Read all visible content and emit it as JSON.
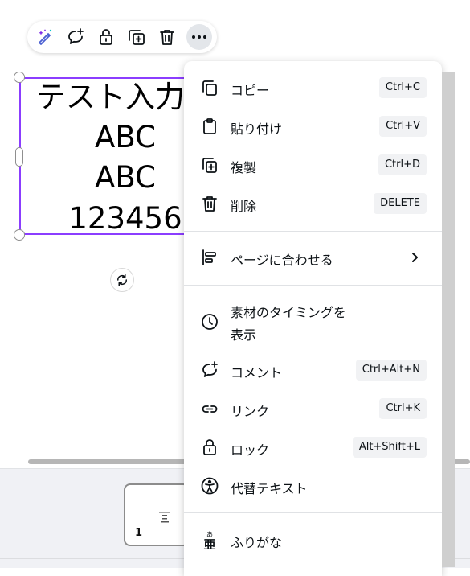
{
  "textbox": {
    "lines": [
      "テスト入力中",
      "ABC",
      "ABC",
      "123456"
    ]
  },
  "toolbar": {
    "buttons": [
      "magic-edit",
      "add-comment",
      "lock",
      "duplicate",
      "delete",
      "more"
    ]
  },
  "menu": {
    "items": [
      {
        "label": "コピー",
        "shortcut": "Ctrl+C"
      },
      {
        "label": "貼り付け",
        "shortcut": "Ctrl+V"
      },
      {
        "label": "複製",
        "shortcut": "Ctrl+D"
      },
      {
        "label": "削除",
        "shortcut": "DELETE"
      },
      {
        "label": "ページに合わせる",
        "shortcut": ""
      },
      {
        "label_line1": "素材のタイミングを",
        "label_line2": "表示",
        "shortcut": ""
      },
      {
        "label": "コメント",
        "shortcut": "Ctrl+Alt+N"
      },
      {
        "label": "リンク",
        "shortcut": "Ctrl+K"
      },
      {
        "label": "ロック",
        "shortcut": "Alt+Shift+L"
      },
      {
        "label": "代替テキスト",
        "shortcut": ""
      },
      {
        "label": "ふりがな",
        "shortcut": ""
      }
    ]
  },
  "pages": {
    "current_page_number": "1"
  },
  "colors": {
    "selection": "#8b3dff",
    "text": "#0d1216",
    "kbd_bg": "#f1f2f4",
    "magic": "#7d2ae8"
  }
}
